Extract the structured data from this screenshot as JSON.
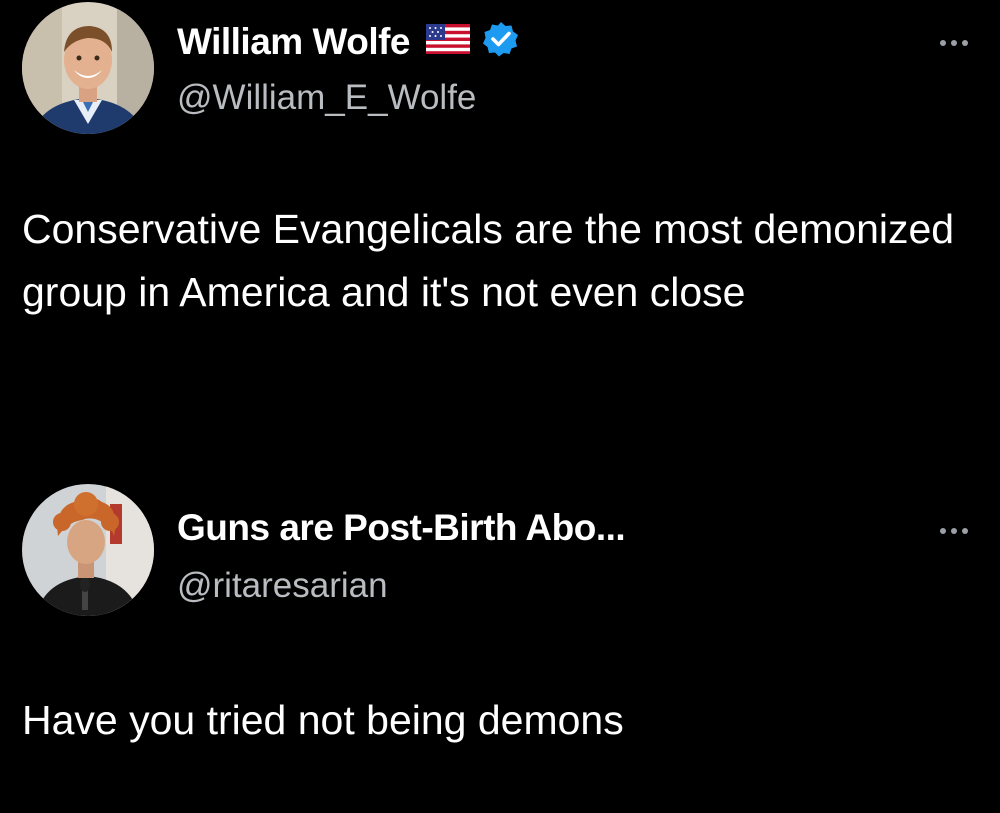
{
  "tweets": [
    {
      "display_name": "William Wolfe",
      "handle": "@William_E_Wolfe",
      "has_flag": true,
      "verified": true,
      "avatar_icon": "profile-photo-man-suit",
      "text": "Conservative Evangelicals are the most demonized group in America and it's not even close",
      "more_icon": "more-options-icon"
    },
    {
      "display_name": "Guns are Post-Birth Abo...",
      "handle": "@ritaresarian",
      "has_flag": false,
      "verified": false,
      "avatar_icon": "profile-photo-curly-hair",
      "text": "Have you tried not being demons",
      "more_icon": "more-options-icon"
    }
  ],
  "colors": {
    "background": "#000000",
    "text_primary": "#ffffff",
    "text_secondary": "#b9bcc0",
    "verified_blue": "#1d9bf0"
  }
}
